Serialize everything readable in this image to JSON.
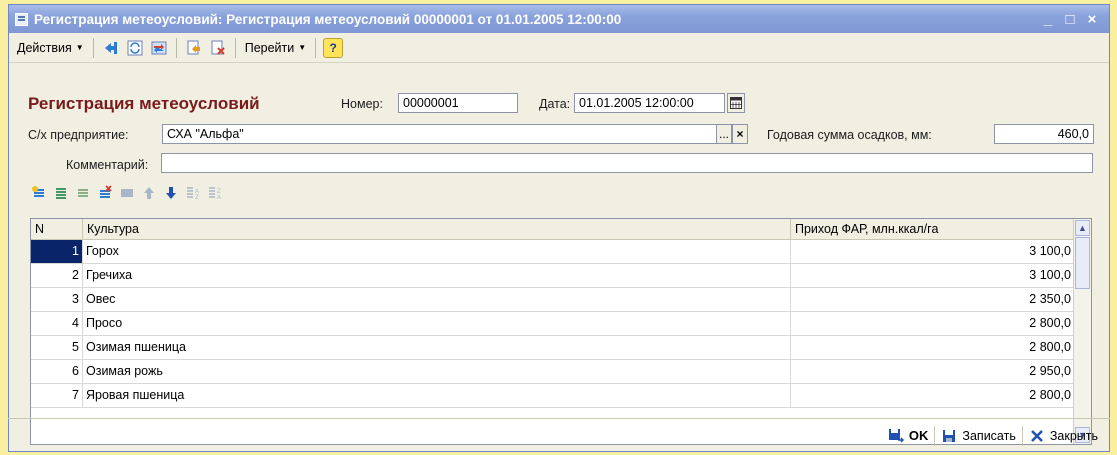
{
  "window": {
    "title": "Регистрация метеоусловий: Регистрация метеоусловий 00000001 от 01.01.2005 12:00:00",
    "minimize": "_",
    "maximize": "□",
    "close": "×"
  },
  "toolbar": {
    "actions_label": "Действия",
    "goto_label": "Перейти",
    "help_label": "?"
  },
  "form": {
    "title": "Регистрация метеоусловий",
    "number_label": "Номер:",
    "number_value": "00000001",
    "date_label": "Дата:",
    "date_value": "01.01.2005 12:00:00",
    "enterprise_label": "С/х предприятие:",
    "enterprise_value": "СХА \"Альфа\"",
    "enterprise_select": "...",
    "enterprise_clear": "×",
    "precip_label": "Годовая сумма осадков, мм:",
    "precip_value": "460,0",
    "comment_label": "Комментарий:",
    "comment_value": ""
  },
  "table": {
    "columns": [
      "N",
      "Культура",
      "Приход ФАР, млн.ккал/га"
    ],
    "rows": [
      {
        "n": "1",
        "crop": "Горох",
        "far": "3 100,0"
      },
      {
        "n": "2",
        "crop": "Гречиха",
        "far": "3 100,0"
      },
      {
        "n": "3",
        "crop": "Овес",
        "far": "2 350,0"
      },
      {
        "n": "4",
        "crop": "Просо",
        "far": "2 800,0"
      },
      {
        "n": "5",
        "crop": "Озимая пшеница",
        "far": "2 800,0"
      },
      {
        "n": "6",
        "crop": "Озимая рожь",
        "far": "2 950,0"
      },
      {
        "n": "7",
        "crop": "Яровая пшеница",
        "far": "2 800,0"
      }
    ]
  },
  "footer": {
    "ok_label": "OK",
    "save_label": "Записать",
    "close_label": "Закрыть"
  },
  "colors": {
    "title_bar": "#8aa2dc",
    "form_title": "#7a1a1a",
    "selection": "#0a246a",
    "background": "#f8efa0"
  }
}
